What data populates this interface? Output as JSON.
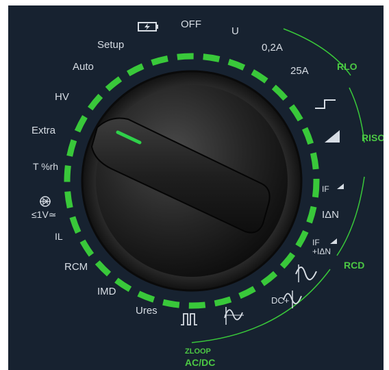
{
  "dial": {
    "selected": "T %rh",
    "left_labels": {
      "setup": "Setup",
      "auto": "Auto",
      "hv": "HV",
      "extra": "Extra",
      "t_rh": "T %rh",
      "le1v": "≤1V≃",
      "il": "IL",
      "rcm": "RCM",
      "imd": "IMD",
      "ures": "Ures"
    },
    "top_labels": {
      "off": "OFF",
      "u": "U",
      "a02": "0,2A",
      "a25": "25A"
    },
    "right_labels": {
      "idn": "IΔN",
      "if": "IF",
      "if_idn": "IF +IΔN",
      "dc_plus": "DC+"
    },
    "groups": {
      "rlo": "RLO",
      "riso": "RISO",
      "rcd": "RCD",
      "zloop": "ZLOOP",
      "acdc": "AC/DC"
    },
    "icons": [
      "battery-charge-icon",
      "step-icon",
      "ramp-icon",
      "pulse-icon",
      "half-wave-icon",
      "sine-icon",
      "dc-sine-icon",
      "continuity-icon"
    ]
  },
  "colors": {
    "panel": "#172230",
    "accent": "#39c83a",
    "knob": "#1c1c1c",
    "label": "#d7dde4"
  }
}
